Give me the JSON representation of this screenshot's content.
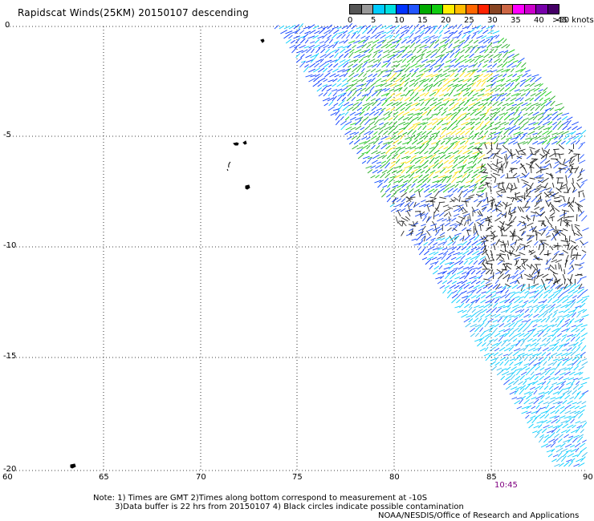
{
  "header": {
    "title": "Rapidscat Winds(25KM) 20150107 descending"
  },
  "legend": {
    "colors": [
      "#555555",
      "#999999",
      "#00ccff",
      "#00e0e0",
      "#0033ff",
      "#2255ff",
      "#00aa00",
      "#11cc11",
      "#ffee00",
      "#ffbb00",
      "#ff6600",
      "#ff2200",
      "#884422",
      "#cc6644",
      "#ff00ff",
      "#cc00cc",
      "#7700aa",
      "#440066"
    ],
    "labels": [
      "0",
      "5",
      "10",
      "15",
      "20",
      "25",
      "30",
      "35",
      "40",
      "45",
      ">50 knots"
    ]
  },
  "axes": {
    "y_labels": [
      "0",
      "-5",
      "-10",
      "-15",
      "-20"
    ],
    "x_labels": [
      "60",
      "65",
      "70",
      "75",
      "80",
      "85",
      "90"
    ]
  },
  "swath_time": "10:45",
  "notes": {
    "line1": "Note: 1) Times are GMT 2)Times along bottom correspond to measurement at -10S",
    "line2": "3)Data buffer is 22 hrs from 20150107 4) Black circles indicate possible contamination",
    "line3": "NOAA/NESDIS/Office of Research and Applications"
  }
}
